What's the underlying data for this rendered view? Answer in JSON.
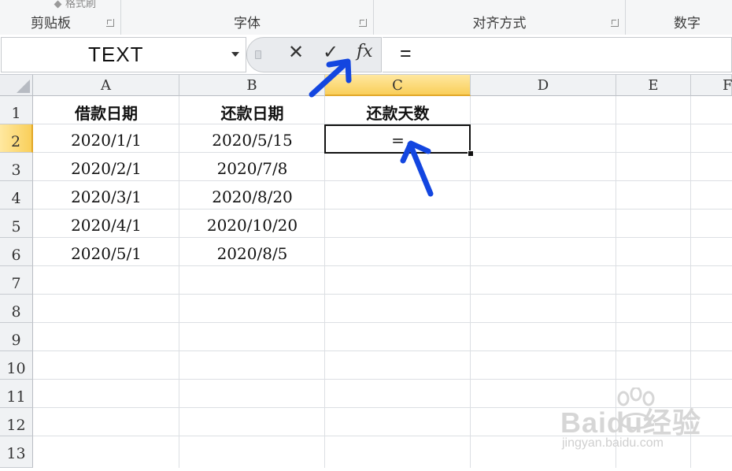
{
  "ribbon": {
    "partial_top_label": "格式刷",
    "groups": [
      {
        "label": "剪贴板"
      },
      {
        "label": "字体"
      },
      {
        "label": "对齐方式"
      },
      {
        "label": "数字"
      }
    ]
  },
  "formula_bar": {
    "name_box": "TEXT",
    "cancel_glyph": "✕",
    "enter_glyph": "✓",
    "fx_label": "fx",
    "formula": "="
  },
  "sheet": {
    "columns": [
      "A",
      "B",
      "C",
      "D",
      "E",
      "F"
    ],
    "active_column": "C",
    "rows": [
      "1",
      "2",
      "3",
      "4",
      "5",
      "6",
      "7",
      "8",
      "9",
      "10",
      "11",
      "12",
      "13"
    ],
    "active_row": "2",
    "headers": {
      "a": "借款日期",
      "b": "还款日期",
      "c": "还款天数"
    },
    "data": [
      {
        "a": "2020/1/1",
        "b": "2020/5/15",
        "c": "="
      },
      {
        "a": "2020/2/1",
        "b": "2020/7/8",
        "c": ""
      },
      {
        "a": "2020/3/1",
        "b": "2020/8/20",
        "c": ""
      },
      {
        "a": "2020/4/1",
        "b": "2020/10/20",
        "c": ""
      },
      {
        "a": "2020/5/1",
        "b": "2020/8/5",
        "c": ""
      }
    ]
  },
  "annotations": {
    "color": "#1346e0"
  },
  "watermark": {
    "brand": "Baidu经验",
    "url": "jingyan.baidu.com"
  },
  "icons": [
    "dialog-launcher-icon",
    "dropdown-arrow-icon",
    "cancel-icon",
    "enter-check-icon",
    "insert-function-icon",
    "select-all-icon",
    "paw-icon"
  ]
}
